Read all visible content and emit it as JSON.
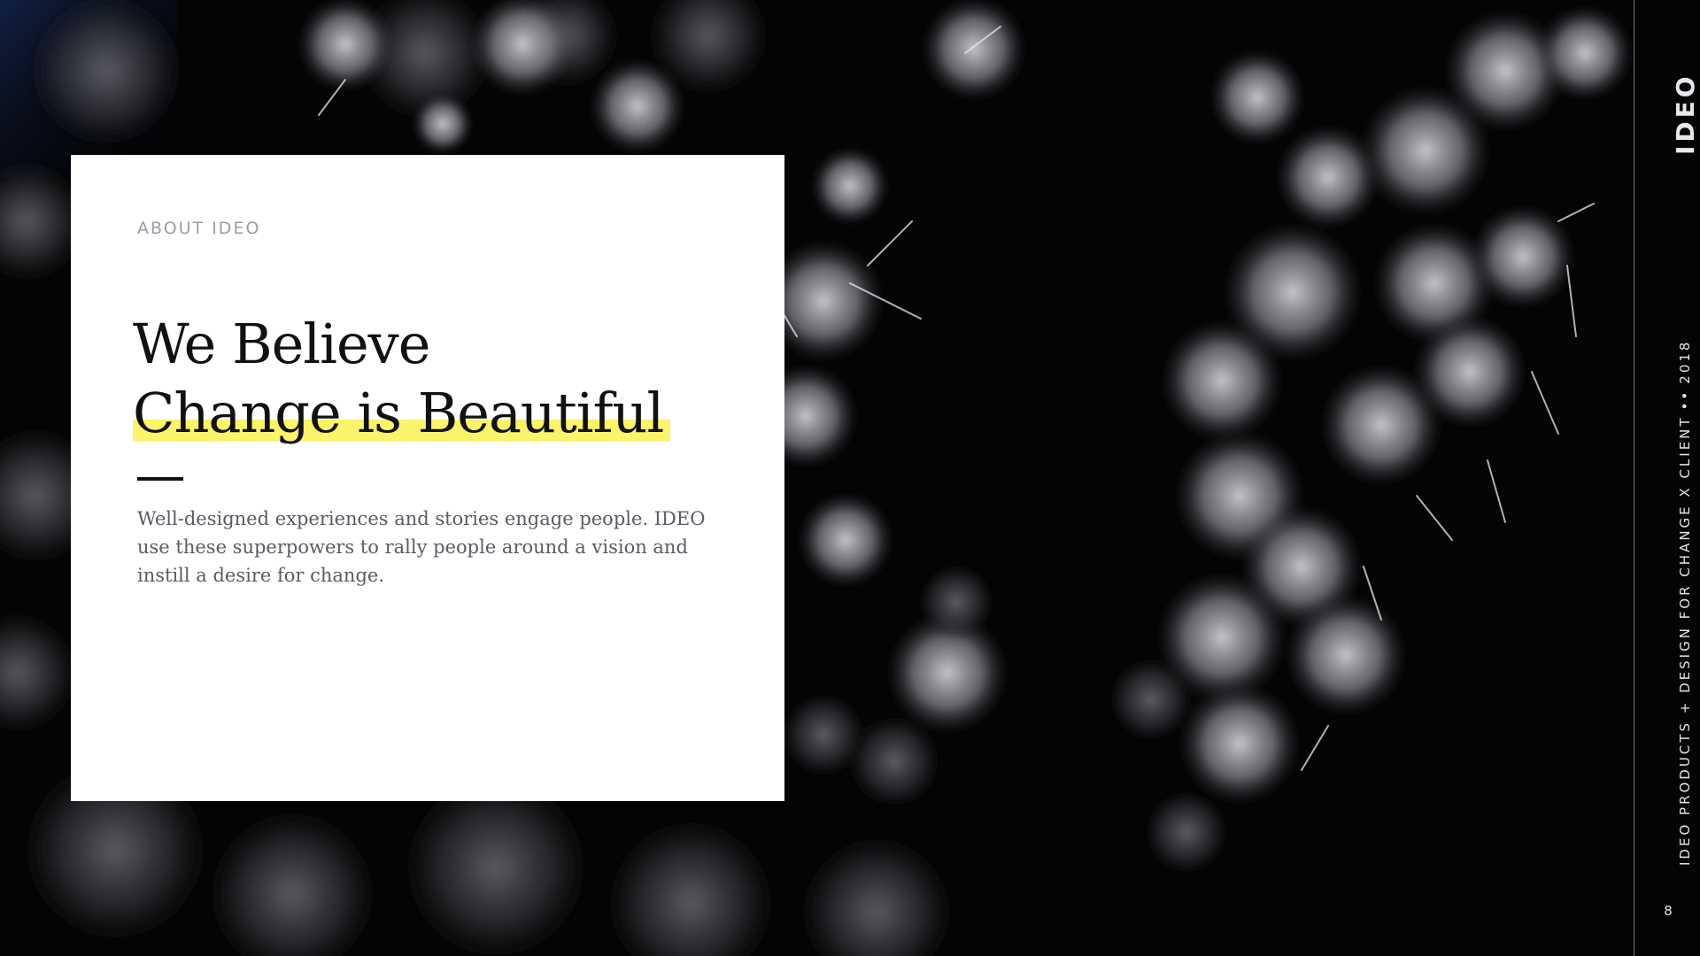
{
  "slide": {
    "eyebrow": "ABOUT IDEO",
    "headline_line1": "We Believe",
    "headline_line2": "Change is Beautiful",
    "body": "Well-designed experiences and stories engage people. IDEO use these superpowers to rally people around a vision and instill a desire for change.",
    "highlight_color": "#fbf36a"
  },
  "sidebar": {
    "logo": "IDEO",
    "footer_left": "IDEO PRODUCTS + DESIGN FOR CHANGE X CLIENT",
    "footer_separator": "••",
    "footer_year": "2018",
    "page_number": "8"
  },
  "background": {
    "subject": "frost-crystal-photo"
  }
}
